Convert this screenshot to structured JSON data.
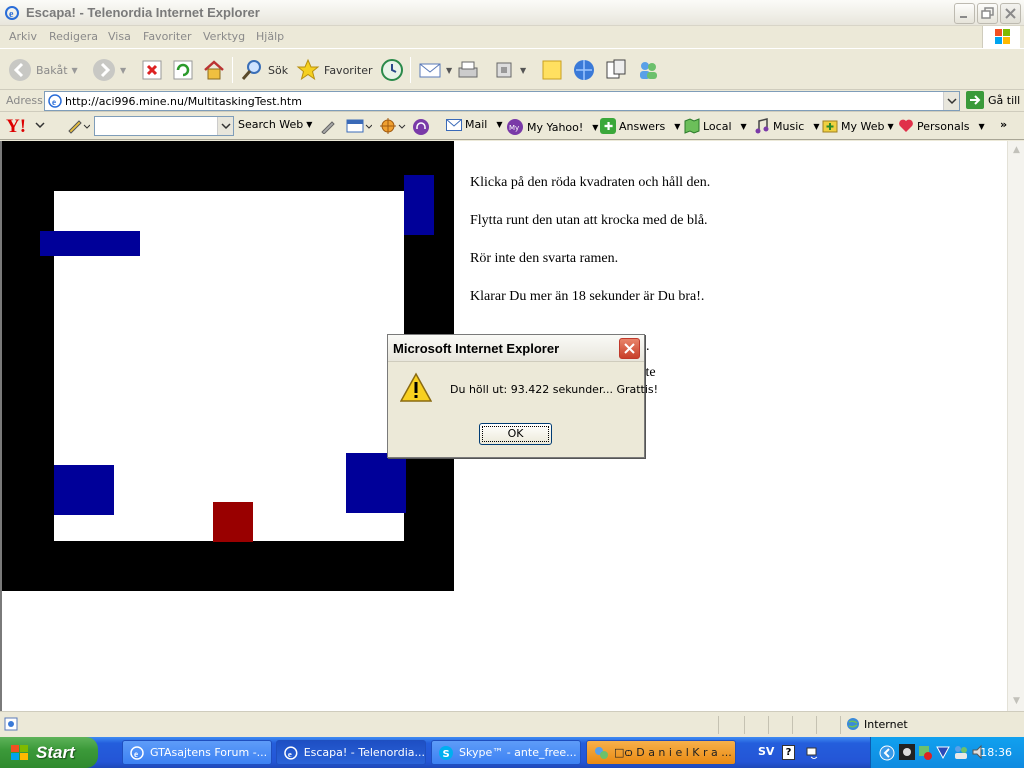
{
  "window": {
    "title": "Escapa! - Telenordia Internet Explorer"
  },
  "menu": {
    "items": [
      "Arkiv",
      "Redigera",
      "Visa",
      "Favoriter",
      "Verktyg",
      "Hjälp"
    ]
  },
  "toolbar": {
    "back_label": "Bakåt",
    "search_label": "Sök",
    "favorites_label": "Favoriter"
  },
  "address": {
    "label": "Adress",
    "url": "http://aci996.mine.nu/MultitaskingTest.htm",
    "go_label": "Gå till"
  },
  "yahoo": {
    "search_placeholder": "",
    "search_label": "Search Web",
    "mail_label": "Mail",
    "myyahoo_label": "My Yahoo!",
    "answers_label": "Answers",
    "local_label": "Local",
    "music_label": "Music",
    "myweb_label": "My Web",
    "personals_label": "Personals"
  },
  "page": {
    "instructions": [
      "Klicka på den röda kvadraten och håll den.",
      "Flytta runt den utan att krocka med de blå.",
      "Rör inte den svarta ramen.",
      "Klarar Du mer än 18 sekunder är Du bra!."
    ],
    "frag_1": ".",
    "frag_2": "ste"
  },
  "dialog": {
    "title": "Microsoft Internet Explorer",
    "message": "Du höll ut: 93.422 sekunder... Grattis!",
    "ok_label": "OK"
  },
  "status": {
    "zone_label": "Internet"
  },
  "taskbar": {
    "start_label": "Start",
    "tasks": [
      "GTAsajtens Forum -...",
      "Escapa! - Telenordia...",
      "Skype™ - ante_free...",
      "□ѻ D a n i e l  K r a ..."
    ],
    "language": "SV",
    "clock": "18:36"
  },
  "colors": {
    "game_frame": "#000000",
    "blue_block": "#000099",
    "red_square": "#990000"
  }
}
